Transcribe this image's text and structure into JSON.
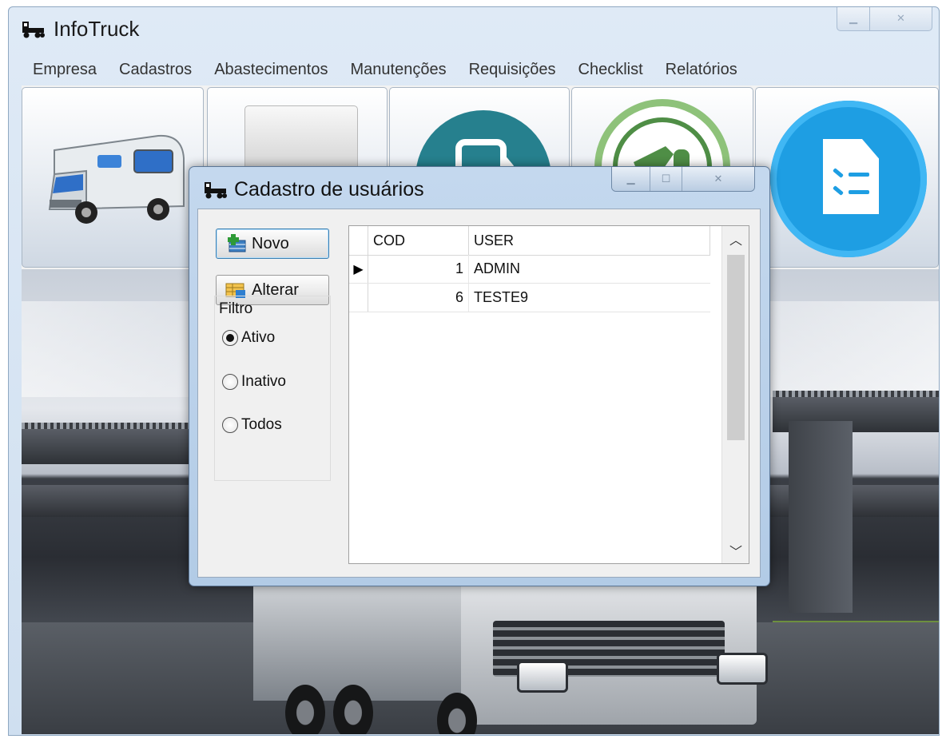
{
  "app": {
    "title": "InfoTruck"
  },
  "menu": [
    "Empresa",
    "Cadastros",
    "Abastecimentos",
    "Manutenções",
    "Requisições",
    "Checklist",
    "Relatórios"
  ],
  "dialog": {
    "title": "Cadastro de usuários",
    "buttons": {
      "novo": "Novo",
      "alterar": "Alterar"
    },
    "filter": {
      "label": "Filtro",
      "options": [
        "Ativo",
        "Inativo",
        "Todos"
      ],
      "selected": "Ativo"
    },
    "grid": {
      "columns": [
        "COD",
        "USER"
      ],
      "rows": [
        {
          "cod": "1",
          "user": "ADMIN",
          "current": true
        },
        {
          "cod": "6",
          "user": "TESTE9",
          "current": false
        }
      ]
    }
  },
  "icons": [
    "truck-icon",
    "rv-icon",
    "fuel-icon",
    "wrench-icon",
    "checklist-icon"
  ],
  "colors": {
    "checklist_blue": "#1e9ee3",
    "fuel_teal": "#26808e",
    "wrench_green": "#4f8e46"
  }
}
